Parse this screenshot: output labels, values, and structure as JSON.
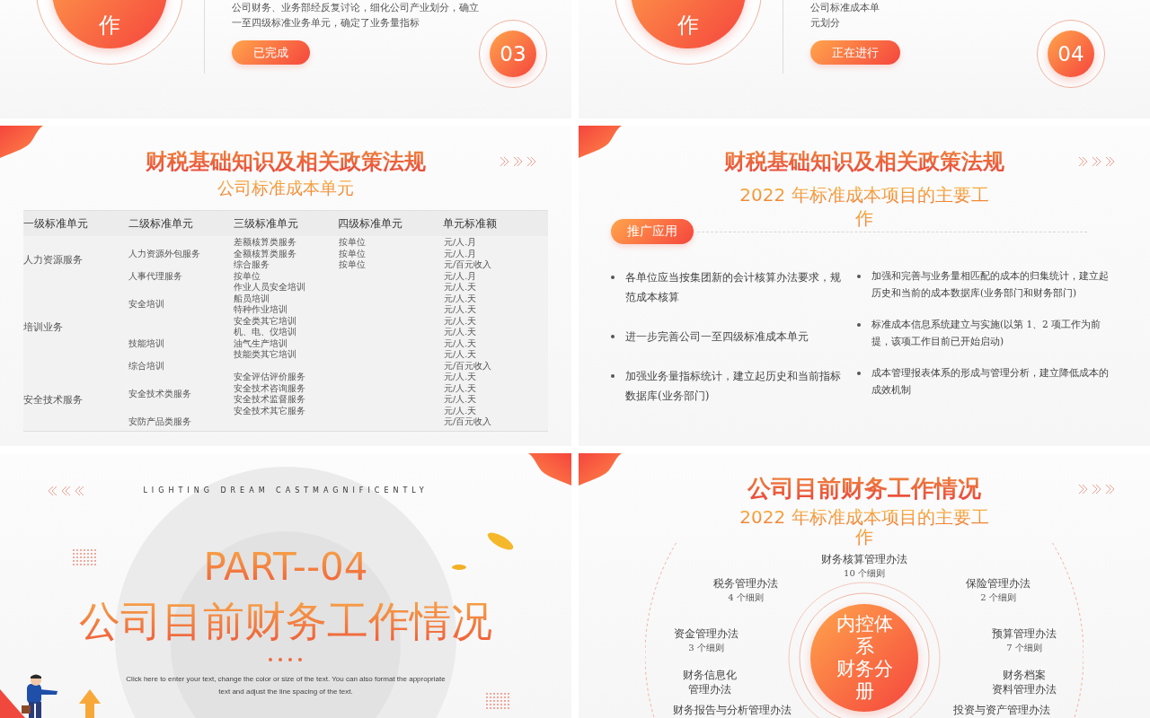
{
  "slides": [
    {
      "kind": "progress",
      "circle_text": "作",
      "description": [
        "公司财务、业务部经反复讨论，细化公司产业划分，确立",
        "一至四级标准业务单元，确定了业务量指标"
      ],
      "status": "已完成",
      "number": "03"
    },
    {
      "kind": "progress",
      "circle_text": "作",
      "description": [
        "公司标准成本单",
        "元划分"
      ],
      "status": "正在进行",
      "number": "04"
    },
    {
      "kind": "table",
      "title": "财税基础知识及相关政策法规",
      "subtitle_lines": [
        "公司标准成本单元"
      ],
      "table": {
        "columns": [
          "一级标准单元",
          "二级标准单元",
          "三级标准单元",
          "四级标准单元",
          "单元标准额"
        ],
        "groups": [
          {
            "name": "人力资源服务",
            "subgroups": [
              {
                "name": "人力资源外包服务",
                "items": [
                  {
                    "level3": "差额核算类服务",
                    "level4": "按单位",
                    "amount": "元/人.月"
                  },
                  {
                    "level3": "全额核算类服务",
                    "level4": "按单位",
                    "amount": "元/人.月"
                  },
                  {
                    "level3": "综合服务",
                    "level4": "按单位",
                    "amount": "元/百元收入"
                  }
                ]
              },
              {
                "name": "人事代理服务",
                "items": [
                  {
                    "level3": "按单位",
                    "amount": "元/人.月"
                  }
                ]
              }
            ]
          },
          {
            "name": "培训业务",
            "subgroups": [
              {
                "name": "安全培训",
                "items": [
                  {
                    "level3": "作业人员安全培训",
                    "amount": "元/人.天"
                  },
                  {
                    "level3": "船员培训",
                    "amount": "元/人.天"
                  },
                  {
                    "level3": "特种作业培训",
                    "amount": "元/人.天"
                  },
                  {
                    "level3": "安全类其它培训",
                    "amount": "元/人.天"
                  }
                ]
              },
              {
                "name": "技能培训",
                "items": [
                  {
                    "level3": "机、电、仪培训",
                    "amount": "元/人.天"
                  },
                  {
                    "level3": "油气生产培训",
                    "amount": "元/人.天"
                  },
                  {
                    "level3": "技能类其它培训",
                    "amount": "元/人.天"
                  }
                ]
              },
              {
                "name": "综合培训",
                "items": [
                  {
                    "amount": "元/百元收入"
                  }
                ]
              }
            ]
          },
          {
            "name": "安全技术服务",
            "subgroups": [
              {
                "name": "安全技术类服务",
                "items": [
                  {
                    "level3": "安全评估评价服务",
                    "amount": "元/人.天"
                  },
                  {
                    "level3": "安全技术咨询服务",
                    "amount": "元/人.天"
                  },
                  {
                    "level3": "安全技术监督服务",
                    "amount": "元/人.天"
                  },
                  {
                    "level3": "安全技术其它服务",
                    "amount": "元/人.天"
                  }
                ]
              },
              {
                "name": "安防产品类服务",
                "items": [
                  {
                    "amount": "元/百元收入"
                  }
                ]
              }
            ]
          }
        ]
      }
    },
    {
      "kind": "list",
      "title": "财税基础知识及相关政策法规",
      "subtitle_lines": [
        "2022 年标准成本项目的主要工",
        "作"
      ],
      "tag": "推广应用",
      "left_bullets": [
        "各单位应当按集团新的会计核算办法要求，规范成本核算",
        "进一步完善公司一至四级标准成本单元",
        "加强业务量指标统计，建立起历史和当前指标数据库(业务部门)"
      ],
      "right_bullets": [
        "加强和完善与业务量相匹配的成本的归集统计，建立起历史和当前的成本数据库(业务部门和财务部门)",
        "标准成本信息系统建立与实施(以第 1、2 项工作为前提，该项工作目前已开始启动)",
        "成本管理报表体系的形成与管理分析，建立降低成本的成效机制"
      ]
    },
    {
      "kind": "cover",
      "tagline": "LIGHTING DREAM CASTMAGNIFICENTLY",
      "part": "PART--04",
      "title": "公司目前财务工作情况",
      "description": "Click here to enter your text, change the color or size of the text. You can also format the appropriate text and adjust the line spacing of the text."
    },
    {
      "kind": "diagram",
      "title": "公司目前财务工作情况",
      "subtitle_lines": [
        "2022 年标准成本项目的主要工",
        "作"
      ],
      "center_lines": [
        "内控体",
        "系",
        "财务分",
        "册"
      ],
      "nodes": [
        {
          "name_lines": [
            "财务核算管理办法"
          ],
          "count": "10 个细则"
        },
        {
          "name_lines": [
            "税务管理办法"
          ],
          "count": "4 个细则"
        },
        {
          "name_lines": [
            "保险管理办法"
          ],
          "count": "2 个细则"
        },
        {
          "name_lines": [
            "资金管理办法"
          ],
          "count": "3 个细则"
        },
        {
          "name_lines": [
            "预算管理办法"
          ],
          "count": "7 个细则"
        },
        {
          "name_lines": [
            "财务信息化",
            "管理办法"
          ]
        },
        {
          "name_lines": [
            "财务档案",
            "资料管理办法"
          ]
        },
        {
          "name_lines": [
            "财务报告与分析管理办法"
          ]
        },
        {
          "name_lines": [
            "投资与资产管理办法"
          ]
        }
      ]
    }
  ]
}
